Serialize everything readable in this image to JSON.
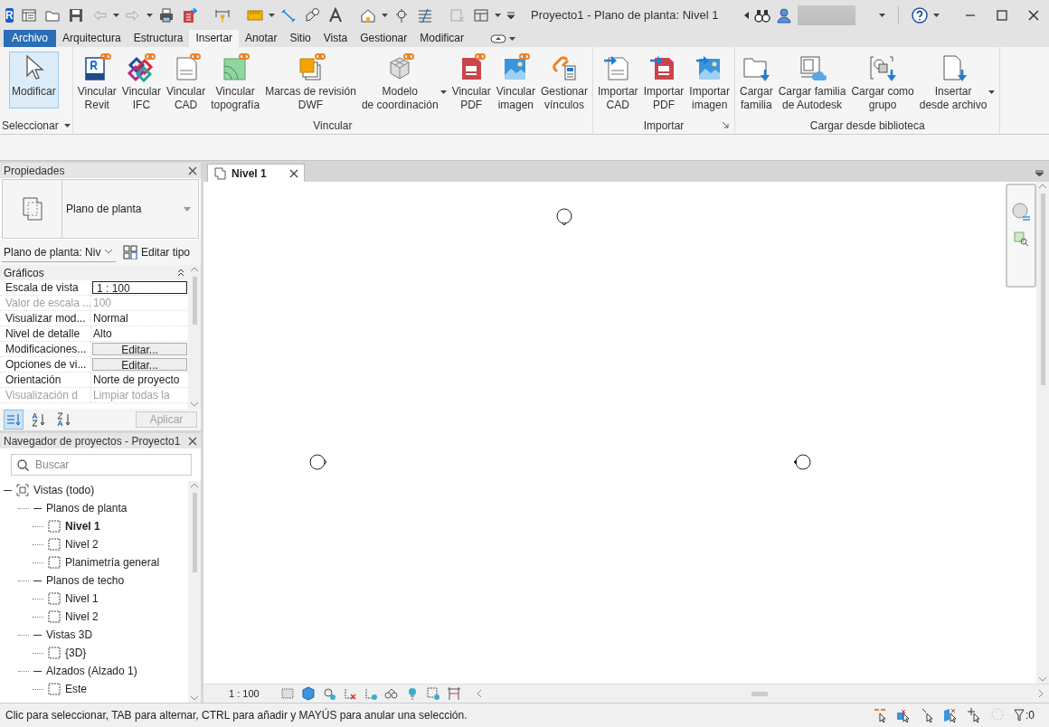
{
  "title_bar": {
    "logo": "R",
    "title": "Proyecto1 - Plano de planta: Nivel 1"
  },
  "ribbon_tabs": [
    {
      "label": "Archivo",
      "kind": "file",
      "selected": false
    },
    {
      "label": "Arquitectura",
      "kind": "tab",
      "selected": false
    },
    {
      "label": "Estructura",
      "kind": "tab",
      "selected": false
    },
    {
      "label": "Insertar",
      "kind": "tab",
      "selected": true
    },
    {
      "label": "Anotar",
      "kind": "tab",
      "selected": false
    },
    {
      "label": "Sitio",
      "kind": "tab",
      "selected": false
    },
    {
      "label": "Vista",
      "kind": "tab",
      "selected": false
    },
    {
      "label": "Gestionar",
      "kind": "tab",
      "selected": false
    },
    {
      "label": "Modificar",
      "kind": "tab",
      "selected": false
    }
  ],
  "ribbon_panels": [
    {
      "title": "Seleccionar",
      "menu": true,
      "buttons": [
        {
          "label": "Modificar",
          "selected": true
        }
      ]
    },
    {
      "title": "Vincular",
      "buttons": [
        {
          "label": "Vincular\nRevit",
          "selected": false
        },
        {
          "label": "Vincular\nIFC",
          "selected": false
        },
        {
          "label": "Vincular\nCAD",
          "selected": false
        },
        {
          "label": "Vincular\ntopografía",
          "selected": false
        },
        {
          "label": "Marcas de revisión\nDWF",
          "selected": false
        },
        {
          "label": "Modelo\nde coordinación",
          "selected": false,
          "dropdown": true
        },
        {
          "label": "Vincular\nPDF",
          "selected": false
        },
        {
          "label": "Vincular\nimagen",
          "selected": false
        },
        {
          "label": "Gestionar\nvínculos",
          "selected": false
        }
      ]
    },
    {
      "title": "Importar",
      "launcher": true,
      "buttons": [
        {
          "label": "Importar\nCAD",
          "selected": false
        },
        {
          "label": "Importar\nPDF",
          "selected": false
        },
        {
          "label": "Importar\nimagen",
          "selected": false
        }
      ]
    },
    {
      "title": "Cargar desde biblioteca",
      "buttons": [
        {
          "label": "Cargar\nfamilia",
          "selected": false
        },
        {
          "label": "Cargar familia\nde Autodesk",
          "selected": false
        },
        {
          "label": "Cargar como\ngrupo",
          "selected": false
        },
        {
          "label": "Insertar\ndesde archivo",
          "selected": false,
          "dropdown": true
        }
      ]
    }
  ],
  "properties": {
    "title": "Propiedades",
    "type_name": "Plano de planta",
    "type_selector": "Plano de planta: Niv",
    "edit_type": "Editar tipo",
    "group": "Gráficos",
    "rows": [
      {
        "name": "Escala de vista",
        "value": "1 : 100",
        "kind": "input",
        "disabled": false
      },
      {
        "name": "Valor de escala ...",
        "value": "100",
        "kind": "text",
        "disabled": true
      },
      {
        "name": "Visualizar mod...",
        "value": "Normal",
        "kind": "text",
        "disabled": false
      },
      {
        "name": "Nivel de detalle",
        "value": "Alto",
        "kind": "text",
        "disabled": false
      },
      {
        "name": "Modificaciones...",
        "value": "Editar...",
        "kind": "button",
        "disabled": false
      },
      {
        "name": "Opciones de vi...",
        "value": "Editar...",
        "kind": "button",
        "disabled": false
      },
      {
        "name": "Orientación",
        "value": "Norte de proyecto",
        "kind": "text",
        "disabled": false
      },
      {
        "name": "Visualización d",
        "value": "Limpiar todas la",
        "kind": "text",
        "disabled": true
      }
    ],
    "sort_modes": [
      {
        "kind": "category",
        "selected": true
      },
      {
        "kind": "ascending",
        "selected": false
      },
      {
        "kind": "descending",
        "selected": false
      }
    ],
    "apply": {
      "label": "Aplicar",
      "disabled": true
    }
  },
  "project_browser": {
    "title": "Navegador de proyectos - Proyecto1",
    "search": {
      "placeholder": "Buscar"
    },
    "tree": [
      {
        "label": "Vistas (todo)",
        "expanded": true,
        "children": [
          {
            "label": "Planos de planta",
            "expanded": true,
            "children": [
              {
                "label": "Nivel 1",
                "selected": true
              },
              {
                "label": "Nivel 2",
                "selected": false
              },
              {
                "label": "Planimetría general",
                "selected": false
              }
            ]
          },
          {
            "label": "Planos de techo",
            "expanded": true,
            "children": [
              {
                "label": "Nivel 1",
                "selected": false
              },
              {
                "label": "Nivel 2",
                "selected": false
              }
            ]
          },
          {
            "label": "Vistas 3D",
            "expanded": true,
            "children": [
              {
                "label": "{3D}",
                "selected": false
              }
            ]
          },
          {
            "label": "Alzados (Alzado 1)",
            "expanded": true,
            "children": [
              {
                "label": "Este",
                "selected": false
              }
            ]
          }
        ]
      }
    ]
  },
  "view_tabs": [
    {
      "label": "Nivel 1",
      "selected": true
    }
  ],
  "view_bar": {
    "scale": "1 : 100"
  },
  "status_bar": {
    "message": "Clic para seleccionar, TAB para alternar, CTRL para añadir y MAYÚS para anular una selección.",
    "filter_count": ":0"
  }
}
